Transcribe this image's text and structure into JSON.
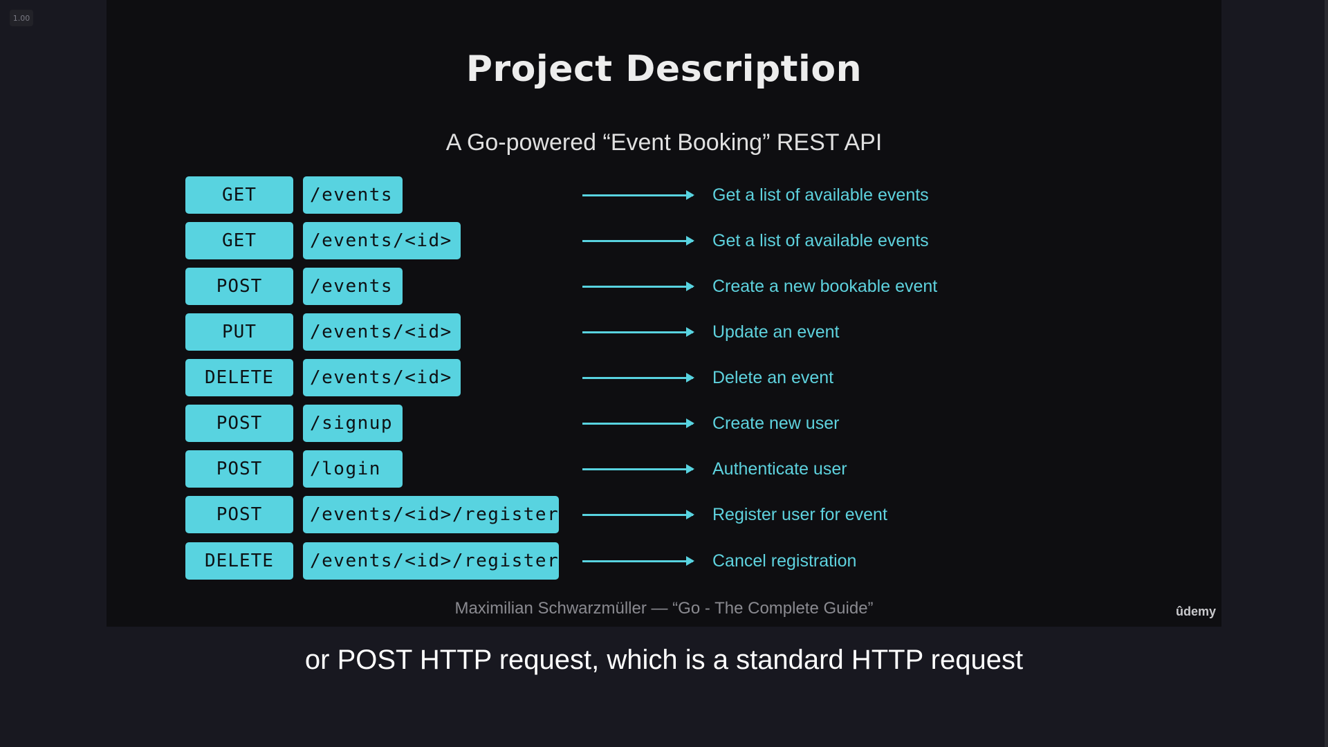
{
  "player": {
    "speed": "1.00",
    "colors": {
      "background": "#181820",
      "slide": "#0e0e11",
      "accent": "#58d3e0",
      "caption": "#ffffff"
    }
  },
  "slide": {
    "title": "Project Description",
    "subtitle": "A Go-powered “Event Booking” REST API",
    "routes": [
      {
        "method": "GET",
        "path": "/events",
        "description": "Get a list of available events"
      },
      {
        "method": "GET",
        "path": "/events/<id>",
        "description": "Get a list of available events"
      },
      {
        "method": "POST",
        "path": "/events",
        "description": "Create a new bookable event"
      },
      {
        "method": "PUT",
        "path": "/events/<id>",
        "description": "Update an event"
      },
      {
        "method": "DELETE",
        "path": "/events/<id>",
        "description": "Delete an event"
      },
      {
        "method": "POST",
        "path": "/signup",
        "description": "Create new user"
      },
      {
        "method": "POST",
        "path": "/login",
        "description": "Authenticate user"
      },
      {
        "method": "POST",
        "path": "/events/<id>/register",
        "description": "Register user for event"
      },
      {
        "method": "DELETE",
        "path": "/events/<id>/register",
        "description": "Cancel registration"
      }
    ],
    "credit": "Maximilian Schwarzmüller — “Go - The Complete Guide”",
    "logo": "ûdemy"
  },
  "caption": "or POST HTTP request, which is a standard HTTP request"
}
